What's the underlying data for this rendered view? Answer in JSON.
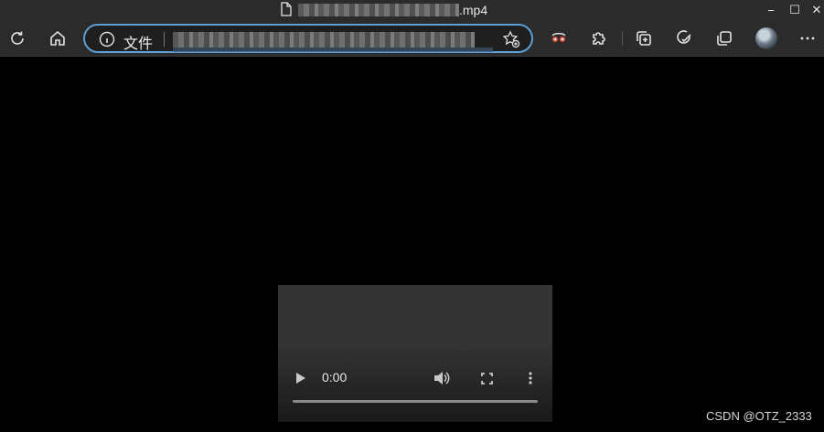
{
  "window": {
    "title_suffix": ".mp4",
    "minimize_label": "−",
    "maximize_label": "☐",
    "close_label": "✕"
  },
  "toolbar": {
    "address_label": "文件"
  },
  "video": {
    "current_time": "0:00",
    "progress": 0
  },
  "watermark": "CSDN @OTZ_2333",
  "colors": {
    "chrome": "#2b2b2b",
    "address_border": "#5aa0d6",
    "page_bg": "#000000"
  }
}
